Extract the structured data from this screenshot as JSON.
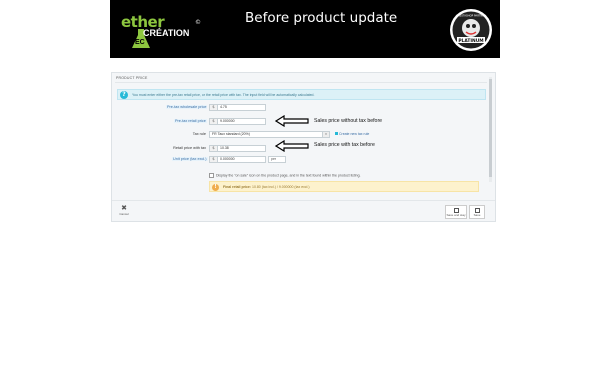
{
  "header": {
    "logo_ether": "ether",
    "logo_creation": "CRÉATION",
    "logo_ec": "EC",
    "logo_copyright": "©",
    "title": "Before product update",
    "badge_top": "PRESTASHOP PARTNER",
    "badge_main": "PLATINUM"
  },
  "panel": {
    "heading": "PRODUCT PRICE",
    "info_text": "You must enter either the pre-tax retail price, or the retail price with tax. The input field will be automatically calculated.",
    "fields": [
      {
        "label": "Pre-tax wholesale price",
        "currency": "$",
        "value": "4.75"
      },
      {
        "label": "Pre-tax retail price",
        "currency": "$",
        "value": "9.000000"
      },
      {
        "label": "Retail price with tax",
        "currency": "$",
        "value": "10.38"
      },
      {
        "label": "Unit price (tax excl.)",
        "currency": "$",
        "value": "0.000000",
        "per": "per"
      }
    ],
    "tax_rule_label": "Tax rule",
    "tax_rule_value": "FR Taux standard (20%)",
    "create_tax_rule": "Create new tax rule",
    "on_sale_text": "Display the \"on sale\" icon on the product page, and in the text found within the product listing.",
    "final_price_label": "Final retail price:",
    "final_price_value": "10.80 (tax incl.) / 9.000000 (tax excl.)",
    "cancel_label": "Cancel",
    "save_stay_label": "Save and stay",
    "save_label": "Save"
  },
  "annotations": {
    "without_tax": "Sales price without tax before",
    "with_tax": "Sales price with tax before"
  },
  "colors": {
    "banner_bg": "#000000",
    "logo_green": "#8dc63f",
    "info_blue": "#25b9d7",
    "warning_bg": "#fdf2cd"
  }
}
